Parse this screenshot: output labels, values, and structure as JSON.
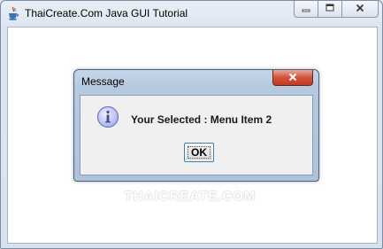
{
  "window": {
    "title": "ThaiCreate.Com Java GUI Tutorial",
    "icon": "java-cup-icon",
    "buttons": [
      "minimize-icon",
      "maximize-icon",
      "close-icon"
    ]
  },
  "watermark": "THAICREATE.COM",
  "dialog": {
    "title": "Message",
    "icon": "information-icon",
    "message": "Your Selected : Menu Item 2",
    "ok_label": "OK",
    "close_icon": "close-icon"
  },
  "colors": {
    "close_button": "#c7472f",
    "info_icon": "#6b79c7",
    "dialog_frame": "#b6c9df"
  }
}
